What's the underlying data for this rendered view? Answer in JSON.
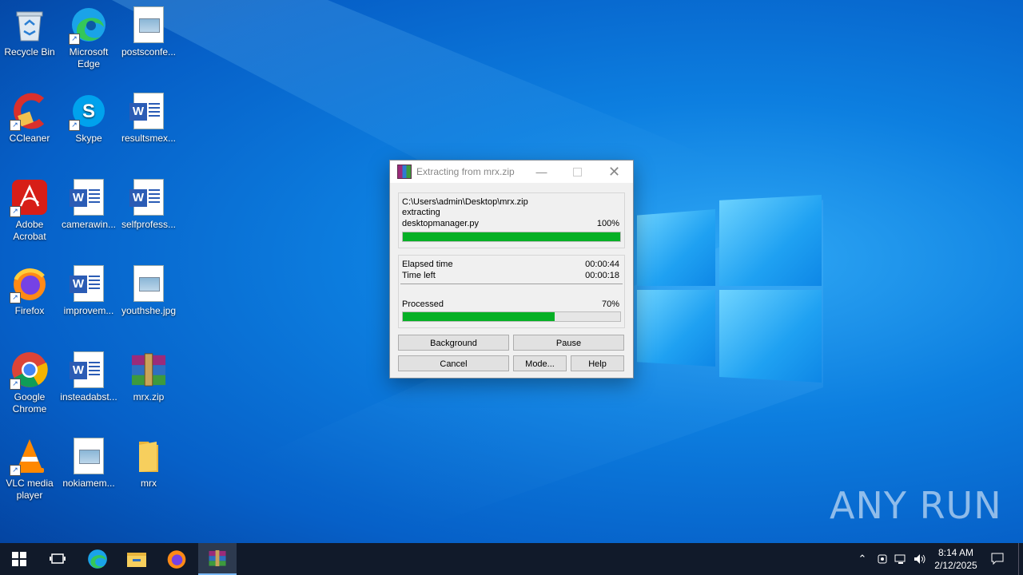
{
  "desktop": {
    "icons": [
      {
        "label": "Recycle Bin"
      },
      {
        "label": "Microsoft Edge"
      },
      {
        "label": "postsconfe..."
      },
      {
        "label": "CCleaner"
      },
      {
        "label": "Skype"
      },
      {
        "label": "resultsmex..."
      },
      {
        "label": "Adobe Acrobat"
      },
      {
        "label": "camerawin..."
      },
      {
        "label": "selfprofess..."
      },
      {
        "label": "Firefox"
      },
      {
        "label": "improvem..."
      },
      {
        "label": "youthshe.jpg"
      },
      {
        "label": "Google Chrome"
      },
      {
        "label": "insteadabst..."
      },
      {
        "label": "mrx.zip"
      },
      {
        "label": "VLC media player"
      },
      {
        "label": "nokiamem..."
      },
      {
        "label": "mrx"
      }
    ]
  },
  "dialog": {
    "title": "Extracting from mrx.zip",
    "archive_path": "C:\\Users\\admin\\Desktop\\mrx.zip",
    "action": "extracting",
    "current_file": "desktopmanager.py",
    "file_percent_text": "100%",
    "file_progress": 1.0,
    "elapsed_label": "Elapsed time",
    "elapsed_value": "00:00:44",
    "timeleft_label": "Time left",
    "timeleft_value": "00:00:18",
    "processed_label": "Processed",
    "processed_percent_text": "70%",
    "processed_progress": 0.7,
    "buttons": {
      "background": "Background",
      "pause": "Pause",
      "cancel": "Cancel",
      "mode": "Mode...",
      "help": "Help"
    }
  },
  "taskbar": {
    "clock_time": "8:14 AM",
    "clock_date": "2/12/2025"
  },
  "watermark": "ANY RUN",
  "colors": {
    "progress": "#06b025",
    "taskbar": "#111a2a"
  }
}
